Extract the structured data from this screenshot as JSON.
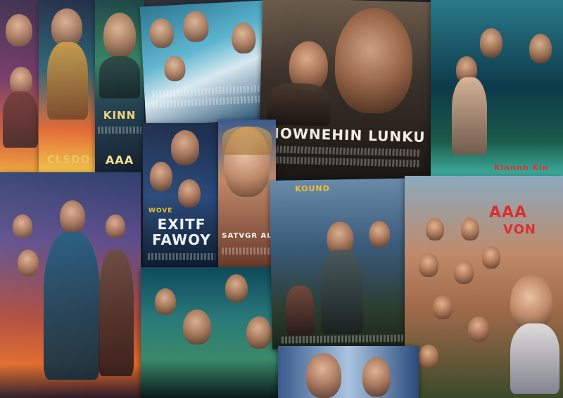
{
  "posters": {
    "p1": {
      "title_top": "",
      "title": "",
      "colors": [
        "#2a1a3a",
        "#c04a2a"
      ]
    },
    "p2": {
      "title": "CLSDO",
      "color": "#e8c25a"
    },
    "p3": {
      "title": "KINN",
      "color": "#f0d27a"
    },
    "p3b": {
      "title": "AAA",
      "color": "#ffe08a"
    },
    "p4": {
      "title": "",
      "colors": [
        "#1e6d8a",
        "#d8e8f0"
      ]
    },
    "p5": {
      "title": "MOWNEHIN LUNKU",
      "color": "#f2ede4"
    },
    "p6": {
      "title": "",
      "colors": [
        "#0d3a4a",
        "#3fb0a0"
      ]
    },
    "p6b": {
      "title": "Kinnnh Kin",
      "color": "#e03030"
    },
    "p7": {
      "title_small": "WOVE",
      "title": "EXITF FAWOY",
      "color": "#f0f2ff"
    },
    "p8": {
      "title": "SATVGR AL",
      "color": "#f5f5f5"
    },
    "p9": {
      "title": "",
      "colors": [
        "#2a3a6a",
        "#e06a2a"
      ]
    },
    "p10": {
      "title": "",
      "colors": [
        "#0e4a5a",
        "#3a8a6a"
      ]
    },
    "p11": {
      "title": "KOUND",
      "color": "#f0c030"
    },
    "p12": {
      "title": "AAA",
      "title2": "VON",
      "color": "#d83030"
    },
    "p13": {
      "title": "",
      "colors": [
        "#3a5a8a",
        "#aac4e0"
      ]
    }
  }
}
